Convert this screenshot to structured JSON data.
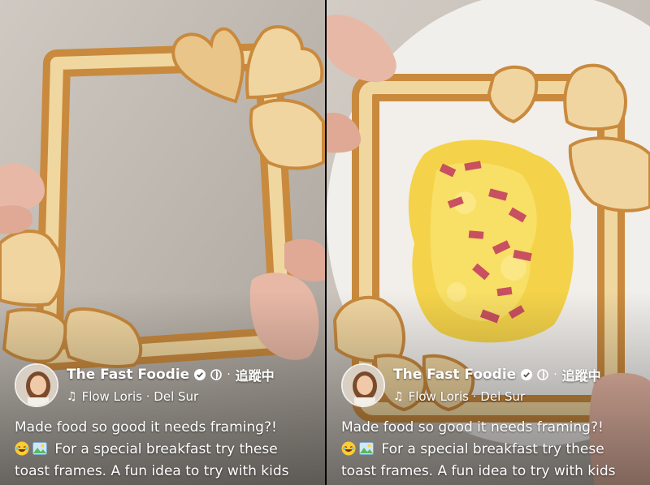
{
  "posts": [
    {
      "author": {
        "name": "The Fast Foodie",
        "follow_label": "追蹤中",
        "separator": "·"
      },
      "music": {
        "track": "Flow Loris · Del Sur"
      },
      "caption": {
        "line1": "Made food so good it needs framing?!",
        "line2": "For a special breakfast try these",
        "line3": "toast frames. A fun idea to try with kids"
      }
    },
    {
      "author": {
        "name": "The Fast Foodie",
        "follow_label": "追蹤中",
        "separator": "·"
      },
      "music": {
        "track": "Flow Loris · Del Sur"
      },
      "caption": {
        "line1": "Made food so good it needs framing?!",
        "line2": "For a special breakfast try these",
        "line3": "toast frames. A fun idea to try with kids"
      }
    }
  ],
  "icons": [
    "verified-icon",
    "globe-icon",
    "music-note-icon",
    "laughing-emoji-icon",
    "picture-emoji-icon"
  ],
  "colors": {
    "toast_crust": "#c9883d",
    "toast_crumb": "#f1d9a6",
    "egg": "#f4d34a",
    "ham": "#c85060",
    "text": "#ffffff"
  }
}
